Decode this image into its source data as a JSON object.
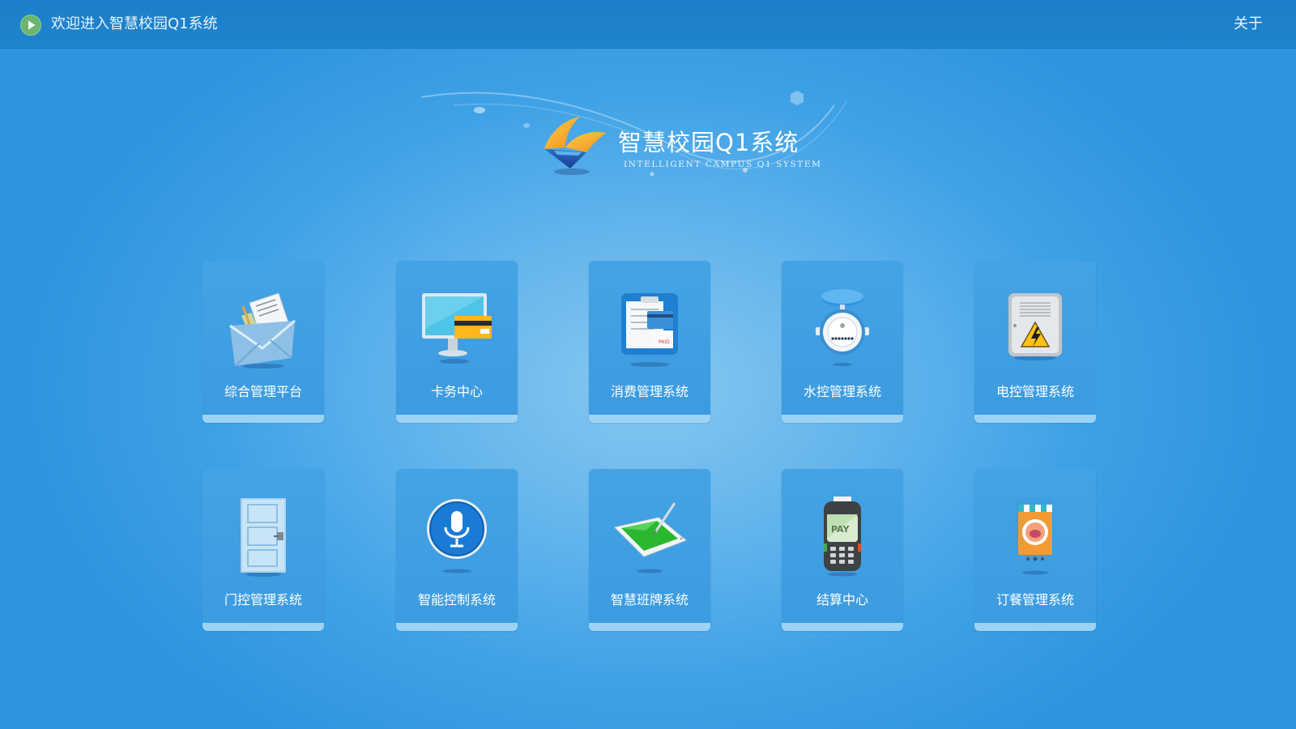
{
  "header": {
    "welcome_text": "欢迎进入智慧校园Q1系统",
    "about_label": "关于"
  },
  "logo": {
    "title": "智慧校园Q1系统",
    "subtitle": "INTELLIGENT CAMPUS Q1 SYSTEM"
  },
  "tiles": [
    {
      "label": "综合管理平台",
      "icon": "envelope-documents-icon"
    },
    {
      "label": "卡务中心",
      "icon": "monitor-card-icon"
    },
    {
      "label": "消费管理系统",
      "icon": "clipboard-receipt-icon"
    },
    {
      "label": "水控管理系统",
      "icon": "water-meter-icon"
    },
    {
      "label": "电控管理系统",
      "icon": "electric-box-icon"
    },
    {
      "label": "门控管理系统",
      "icon": "door-icon"
    },
    {
      "label": "智能控制系统",
      "icon": "microphone-icon"
    },
    {
      "label": "智慧班牌系统",
      "icon": "tablet-pen-icon"
    },
    {
      "label": "结算中心",
      "icon": "pay-terminal-icon"
    },
    {
      "label": "订餐管理系统",
      "icon": "food-order-phone-icon"
    }
  ],
  "colors": {
    "topbar": "#1f84ce",
    "background": "#3fa2e6",
    "tile": "#44a3e4",
    "tile_bottom_stripe": "#9cd3f5",
    "play_icon_green": "#6bb56f"
  }
}
